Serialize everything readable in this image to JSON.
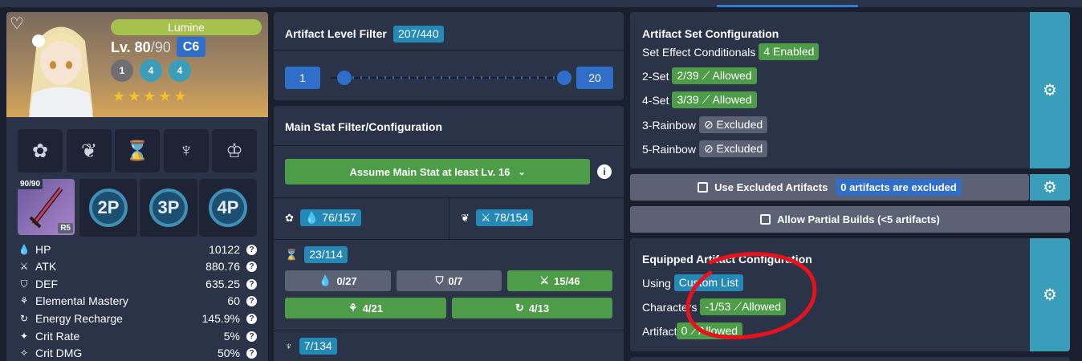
{
  "character": {
    "name": "Lumine",
    "level": "Lv. 80",
    "level_max": "/90",
    "constellation": "C6",
    "talents": [
      "1",
      "4",
      "4"
    ],
    "stars": 5,
    "weapon": {
      "level": "90/90",
      "refinement": "R5"
    },
    "set_icons": [
      "2P",
      "3P",
      "4P"
    ],
    "stats": [
      {
        "label": "HP",
        "value": "10122",
        "icon": "hp-icon"
      },
      {
        "label": "ATK",
        "value": "880.76",
        "icon": "atk-icon"
      },
      {
        "label": "DEF",
        "value": "635.25",
        "icon": "def-icon"
      },
      {
        "label": "Elemental Mastery",
        "value": "60",
        "icon": "em-icon"
      },
      {
        "label": "Energy Recharge",
        "value": "145.9%",
        "icon": "er-icon"
      },
      {
        "label": "Crit Rate",
        "value": "5%",
        "icon": "crit-rate-icon"
      },
      {
        "label": "Crit DMG",
        "value": "50%",
        "icon": "crit-dmg-icon"
      }
    ]
  },
  "level_filter": {
    "title": "Artifact Level Filter",
    "count": "207/440",
    "min": "1",
    "max": "20"
  },
  "main_stat": {
    "title": "Main Stat Filter/Configuration",
    "assume_button": "Assume Main Stat at least Lv. 16",
    "flower": "76/157",
    "plume": "78/154",
    "sands": "23/114",
    "sands_options": [
      {
        "label": "0/27",
        "style": "grey",
        "icon": "hp-icon"
      },
      {
        "label": "0/7",
        "style": "grey",
        "icon": "def-icon"
      },
      {
        "label": "15/46",
        "style": "green",
        "icon": "atk-icon"
      },
      {
        "label": "4/21",
        "style": "green",
        "icon": "em-icon"
      },
      {
        "label": "4/13",
        "style": "green",
        "icon": "er-icon"
      }
    ],
    "goblet": "7/134"
  },
  "set_config": {
    "title": "Artifact Set Configuration",
    "conditionals_label": "Set Effect Conditionals",
    "conditionals_badge": "4 Enabled",
    "rows": [
      {
        "label": "2-Set",
        "badge": "2/39 ⟋ Allowed",
        "style": "green"
      },
      {
        "label": "4-Set",
        "badge": "3/39 ⟋ Allowed",
        "style": "green"
      },
      {
        "label": "3-Rainbow",
        "badge": "⊘ Excluded",
        "style": "grey"
      },
      {
        "label": "5-Rainbow",
        "badge": "⊘ Excluded",
        "style": "grey"
      }
    ]
  },
  "excluded": {
    "label": "Use Excluded Artifacts",
    "badge": "0 artifacts are excluded"
  },
  "partial": {
    "label": "Allow Partial Builds (<5 artifacts)"
  },
  "equipped": {
    "title": "Equipped Artifact Configuration",
    "using_label": "Using",
    "using_badge": "Custom List",
    "characters_label": "Characters",
    "characters_badge": "-1/53 ⟋Allowed",
    "artifacts_label": "Artifacts",
    "artifacts_badge": "0 ⟋Allowed"
  },
  "colors": {
    "background": "#1b2030",
    "card": "#2b3349",
    "accent_blue": "#2589b8",
    "accent_green": "#4d9c48",
    "annotation_red": "#e8121c"
  }
}
